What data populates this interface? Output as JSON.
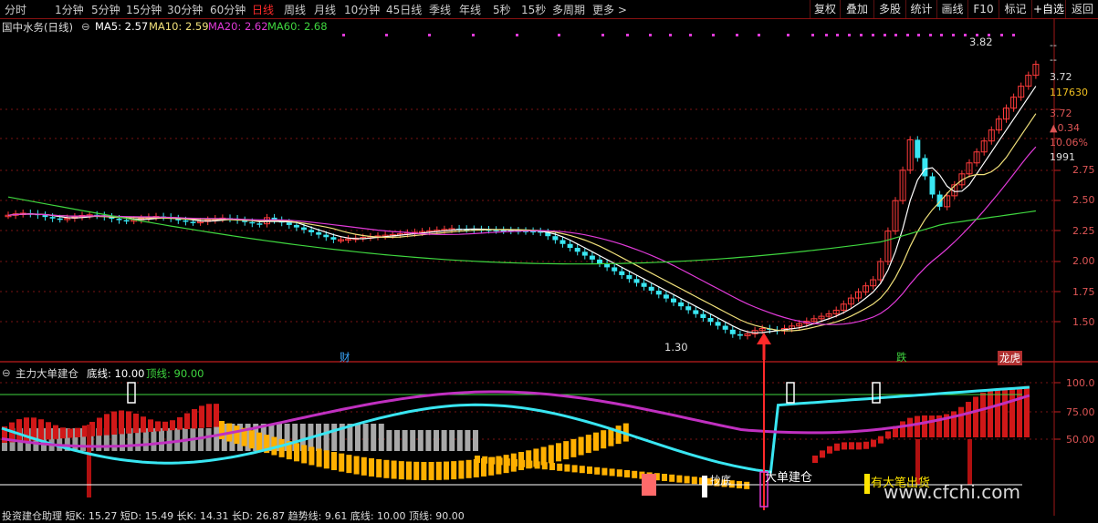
{
  "toolbar": {
    "periods": [
      "分时",
      "1分钟",
      "5分钟",
      "15分钟",
      "30分钟",
      "60分钟",
      "日线",
      "周线",
      "月线",
      "10分钟",
      "45日线",
      "季线",
      "年线",
      "5秒",
      "15秒",
      "多周期",
      "更多 >"
    ],
    "active_period": "日线",
    "right_buttons": [
      "复权",
      "叠加",
      "多股",
      "统计",
      "画线",
      "F10",
      "标记",
      "+自选",
      "返回"
    ]
  },
  "main_header": {
    "stock": "国中水务(日线)",
    "ma5": "MA5: 2.57",
    "ma10": "MA10: 2.59",
    "ma20": "MA20: 2.62",
    "ma60": "MA60: 2.68"
  },
  "right_panel": {
    "dash1": "--",
    "dash2": "--",
    "price1": "3.72",
    "volume": "117630",
    "price2": "3.72",
    "change": "▲0.34",
    "pct": "10.06%",
    "num": "1991"
  },
  "main_axis_labels": [
    "2.75",
    "2.50",
    "2.25",
    "2.00",
    "1.75",
    "1.50"
  ],
  "main_annotations": {
    "high": "3.82",
    "low": "1.30",
    "cai": "财",
    "die": "跌",
    "longhu": "龙虎"
  },
  "sub_header": {
    "title": "主力大单建仓",
    "dixian": "底线: 10.00",
    "dingxian": "顶线: 90.00"
  },
  "sub_axis_labels": [
    "100.0",
    "75.00",
    "50.00"
  ],
  "sub_annotations": {
    "chaodi": "抄底",
    "dadan": "大单建仓",
    "chuhuo": "有大笔出货"
  },
  "footer_text": "投资建仓助理  短K: 15.27  短D: 15.49  长K: 14.31  长D: 26.87  趋势线: 9.61  底线: 10.00  顶线: 90.00",
  "watermark": "www.cfchi.com",
  "colors": {
    "up": "#ff3b3b",
    "down": "#39e6f2",
    "ma5": "#ffffff",
    "ma10": "#f0e07a",
    "ma20": "#e03ad8",
    "ma60": "#3fd63f",
    "grid": "#7a1515"
  }
}
